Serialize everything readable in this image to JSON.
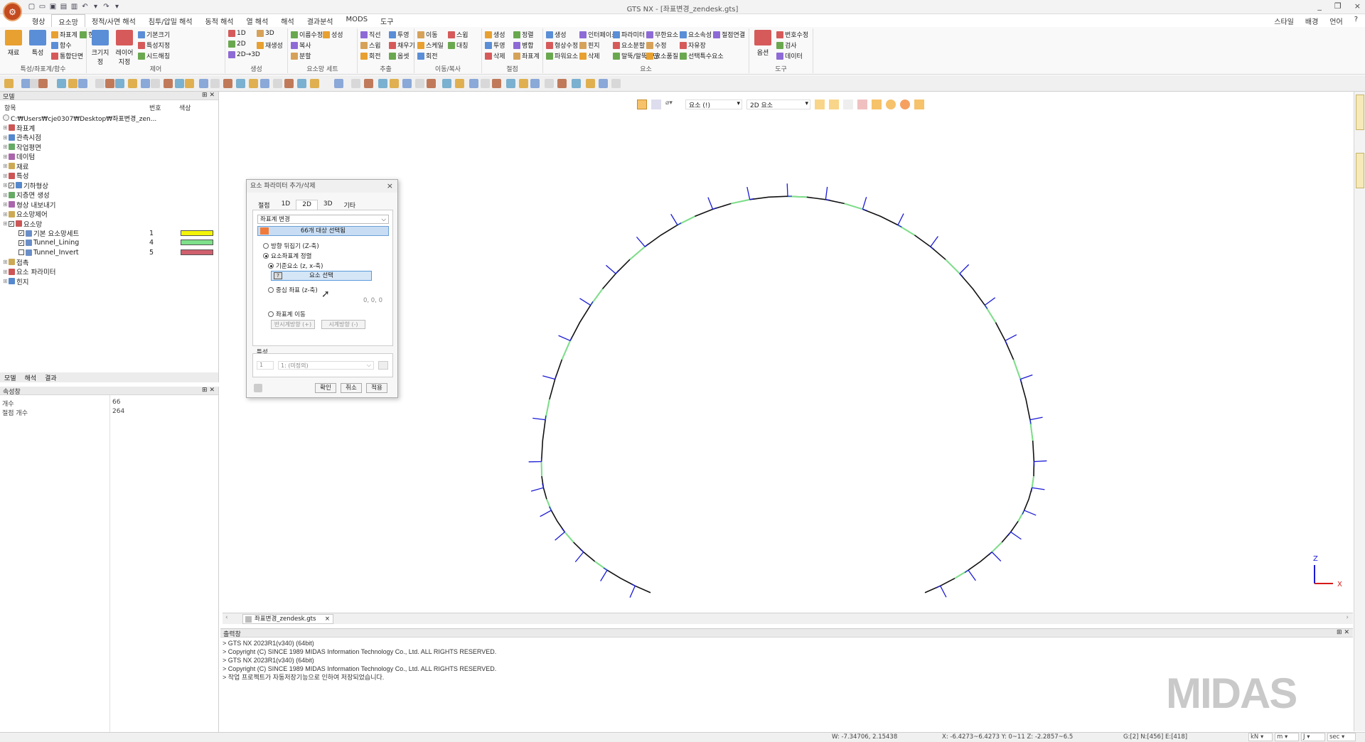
{
  "window": {
    "title": "GTS NX - [좌표변경_zendesk.gts]",
    "controls": [
      "_",
      "❐",
      "×"
    ]
  },
  "menu": {
    "tabs": [
      "형상",
      "요소망",
      "정적/사면 해석",
      "침투/압밀 해석",
      "동적 해석",
      "열 해석",
      "해석",
      "결과분석",
      "MODS",
      "도구"
    ],
    "active": 1,
    "right": [
      "스타일",
      "배경",
      "언어",
      "?"
    ]
  },
  "ribbon": {
    "groups": [
      {
        "label": "특성/좌표계/함수",
        "items": [
          "재료",
          "특성",
          "좌표계",
          "함수",
          "통합단면",
          "힌지"
        ]
      },
      {
        "label": "제어",
        "items": [
          "크기지정",
          "레이어지정",
          "기본크기",
          "특성지정",
          "시드해칭"
        ]
      },
      {
        "label": "생성",
        "items": [
          "1D",
          "2D",
          "2D→3D",
          "3D",
          "재생성"
        ]
      },
      {
        "label": "요소망 세트",
        "items": [
          "이름수정",
          "복사",
          "분할",
          "성성"
        ]
      },
      {
        "label": "추출",
        "items": [
          "직선",
          "스윕",
          "회전",
          "투영",
          "채우기",
          "옵셋"
        ]
      },
      {
        "label": "이동/복사",
        "items": [
          "이동",
          "스케일",
          "회전",
          "스윕",
          "대칭"
        ]
      },
      {
        "label": "절점",
        "items": [
          "생성",
          "투영",
          "삭제",
          "정렬",
          "병합",
          "좌표계"
        ]
      },
      {
        "label": "요소",
        "items": [
          "생성",
          "형상수정",
          "파워요소",
          "인터페이스",
          "핀지",
          "삭제",
          "파라미터",
          "요소분할",
          "말뚝/말뚝말단",
          "무한요소",
          "수정",
          "요소품질",
          "요소속성",
          "자유장",
          "선택특수요소",
          "절점연결"
        ]
      },
      {
        "label": "도구",
        "items": [
          "옵션",
          "번호수정",
          "검사",
          "데이터"
        ]
      }
    ]
  },
  "model_panel": {
    "title": "모델",
    "columns": [
      "항목",
      "번호",
      "색상"
    ],
    "path": "C:₩Users₩cje0307₩Desktop₩좌표변경_zen...",
    "tree": [
      {
        "label": "좌표계",
        "indent": 1,
        "icon": "axis-icon"
      },
      {
        "label": "관측시점",
        "indent": 1,
        "icon": "camera-icon"
      },
      {
        "label": "작업평면",
        "indent": 1,
        "icon": "grid-icon"
      },
      {
        "label": "데이텀",
        "indent": 1,
        "icon": "datum-icon"
      },
      {
        "label": "재료",
        "indent": 1,
        "icon": "material-icon"
      },
      {
        "label": "특성",
        "indent": 1,
        "icon": "property-icon"
      },
      {
        "label": "기하형상",
        "indent": 1,
        "icon": "geometry-icon",
        "checked": true
      },
      {
        "label": "지층면 생성",
        "indent": 1,
        "icon": "layer-icon"
      },
      {
        "label": "형상 내보내기",
        "indent": 1,
        "icon": "export-icon"
      },
      {
        "label": "요소망제어",
        "indent": 1,
        "icon": "mesh-control-icon"
      },
      {
        "label": "요소망",
        "indent": 1,
        "icon": "mesh-icon",
        "checked": true
      },
      {
        "label": "기본 요소망세트",
        "indent": 2,
        "num": "1",
        "color": "#f4f40a",
        "checked": true
      },
      {
        "label": "Tunnel_Lining",
        "indent": 2,
        "num": "4",
        "color": "#7ee08a",
        "checked": true
      },
      {
        "label": "Tunnel_Invert",
        "indent": 2,
        "num": "5",
        "color": "#d0606e",
        "checked": false
      },
      {
        "label": "접촉",
        "indent": 1,
        "icon": "contact-icon"
      },
      {
        "label": "요소 파라미터",
        "indent": 1,
        "icon": "element-param-icon"
      },
      {
        "label": "힌지",
        "indent": 1,
        "icon": "hinge-icon"
      }
    ],
    "bottom_tabs": [
      "모델",
      "해석",
      "결과"
    ]
  },
  "property_panel": {
    "title": "속성창",
    "rows": [
      {
        "k": "개수",
        "v": "66"
      },
      {
        "k": "절점 개수",
        "v": "264"
      }
    ]
  },
  "view_toolbar": {
    "select_mode": "요소 (!)",
    "filter": "2D 요소"
  },
  "dialog": {
    "title": "요소 파라미터 추가/삭제",
    "tabs": [
      "절점",
      "1D",
      "2D",
      "3D",
      "기타"
    ],
    "active_tab": 2,
    "dropdown": "좌표계 변경",
    "selected_button": "66개 대상 선택됨",
    "options": [
      "방향 뒤집기 (Z-축)",
      "요소좌표계 정렬",
      "기준요소 (z, x-축)",
      "중심 좌표 (z-축)",
      "좌표계 이동"
    ],
    "element_select": "요소 선택",
    "coord": "0, 0, 0",
    "ccw": "반시계방향 (+)",
    "cw": "시계방향 (-)",
    "property_label": "특성",
    "property_id": "1",
    "property_value": "1: (미정의)",
    "buttons": [
      "확인",
      "취소",
      "적용"
    ]
  },
  "doc_tab": "좌표변경_zendesk.gts",
  "output": {
    "title": "출력창",
    "lines": [
      "> GTS NX 2023R1(v340) (64bit)",
      "> Copyright (C) SINCE 1989 MIDAS Information Technology Co., Ltd. ALL RIGHTS RESERVED.",
      "> GTS NX 2023R1(v340) (64bit)",
      "> Copyright (C) SINCE 1989 MIDAS Information Technology Co., Ltd. ALL RIGHTS RESERVED.",
      "> 작업 프로젝트가 자동저장기능으로 인하여 저장되었습니다."
    ]
  },
  "watermark": "MIDAS",
  "axis": {
    "z": "Z",
    "x": "X"
  },
  "status": {
    "w": "W: -7.34706, 2.15438",
    "xyz": "X: -6.4273~6.4273 Y: 0~11 Z: -2.2857~6.5",
    "counts": "G:[2] N:[456] E:[418]",
    "units": [
      "kN",
      "m",
      "J",
      "sec"
    ]
  },
  "colors": {
    "accent": "#3a78c4",
    "arrow": "#1a1ad6",
    "lining": "#7ee08a"
  }
}
